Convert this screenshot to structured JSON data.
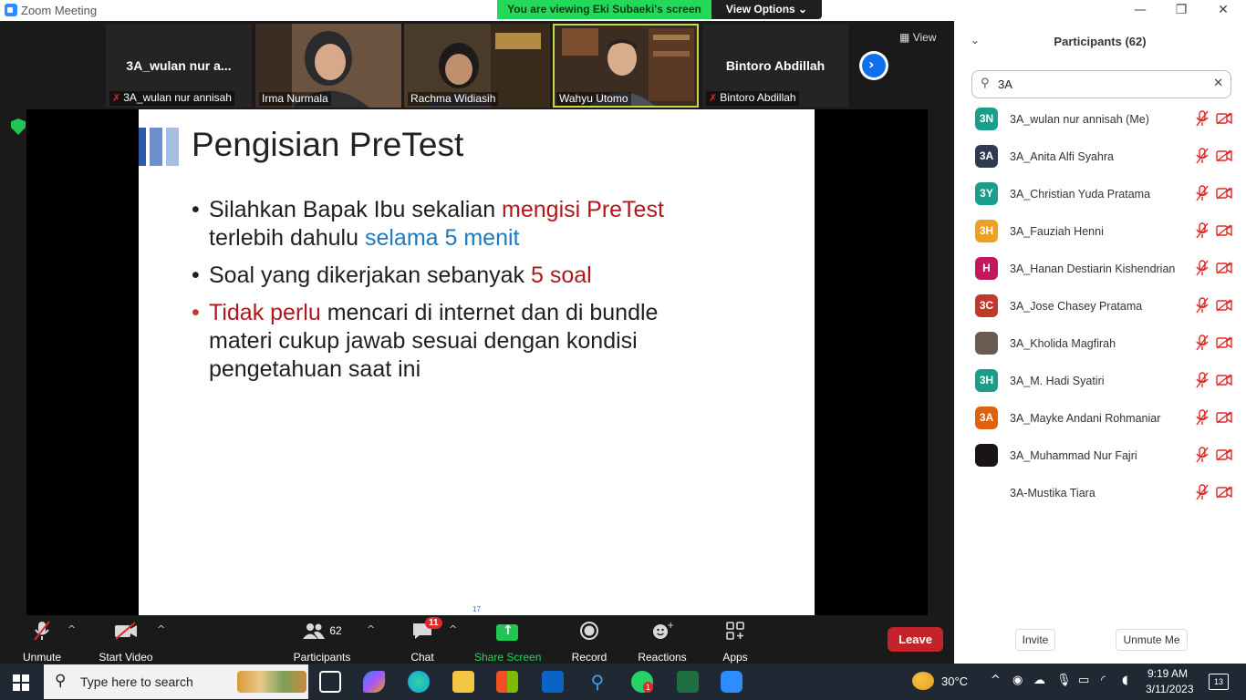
{
  "window": {
    "title": "Zoom Meeting",
    "minimize": "—",
    "restore": "❐",
    "close": "✕"
  },
  "banner": {
    "viewing": "You are viewing Eki Subaeki's screen",
    "view_options": "View Options ⌄"
  },
  "strip": {
    "tiles": [
      {
        "big_name": "3A_wulan nur a...",
        "label": "3A_wulan nur annisah",
        "muted": true
      },
      {
        "label": "Irma Nurmala",
        "muted": false
      },
      {
        "label": "Rachma Widiasih",
        "muted": false
      },
      {
        "label": "Wahyu Utomo",
        "muted": false
      },
      {
        "big_name": "Bintoro Abdillah",
        "label": "Bintoro Abdillah",
        "muted": true
      }
    ],
    "next": "›",
    "view_label": "View"
  },
  "slide": {
    "title": "Pengisian PreTest",
    "b1": {
      "t1": "Silahkan Bapak Ibu sekalian ",
      "t2": "mengisi PreTest",
      "t3": " terlebih dahulu ",
      "t4": "selama 5 menit"
    },
    "b2": {
      "t1": "Soal yang dikerjakan sebanyak ",
      "t2": "5 soal"
    },
    "b3": {
      "t1": "Tidak perlu",
      "t2": " mencari di internet dan di bundle materi cukup jawab sesuai dengan kondisi pengetahuan saat ini"
    },
    "page": "17"
  },
  "toolbar": {
    "unmute": "Unmute",
    "start_video": "Start Video",
    "participants": "Participants",
    "participants_count": "62",
    "chat": "Chat",
    "chat_badge": "11",
    "share_screen": "Share Screen",
    "record": "Record",
    "reactions": "Reactions",
    "apps": "Apps",
    "leave": "Leave"
  },
  "panel": {
    "title": "Participants (62)",
    "search_value": "3A",
    "participants": [
      {
        "initials": "3N",
        "name": "3A_wulan nur annisah (Me)",
        "color": "#1a9e8a"
      },
      {
        "initials": "3A",
        "name": "3A_Anita Alfi Syahra",
        "color": "#2e3b4e"
      },
      {
        "initials": "3Y",
        "name": "3A_Christian Yuda Pratama",
        "color": "#1a9e8a"
      },
      {
        "initials": "3H",
        "name": "3A_Fauziah Henni",
        "color": "#f0a020"
      },
      {
        "initials": "H",
        "name": "3A_Hanan Destiarin Kishendrian",
        "color": "#c2185b"
      },
      {
        "initials": "3C",
        "name": "3A_Jose Chasey Pratama",
        "color": "#c0392b"
      },
      {
        "initials": "",
        "name": "3A_Kholida Magfirah",
        "color": "#6b5a52"
      },
      {
        "initials": "3H",
        "name": "3A_M. Hadi Syatiri",
        "color": "#1a9e8a"
      },
      {
        "initials": "3A",
        "name": "3A_Mayke Andani Rohmaniar",
        "color": "#e0600e"
      },
      {
        "initials": "",
        "name": "3A_Muhammad Nur Fajri",
        "color": "#1a1414"
      },
      {
        "initials": "",
        "name": "3A-Mustika Tiara",
        "color": "#ffffff"
      }
    ],
    "invite": "Invite",
    "unmute_me": "Unmute Me"
  },
  "taskbar": {
    "search_placeholder": "Type here to search",
    "weather": "30°C",
    "time": "9:19 AM",
    "date": "3/11/2023",
    "notif_count": "13",
    "whatsapp_badge": "1"
  }
}
